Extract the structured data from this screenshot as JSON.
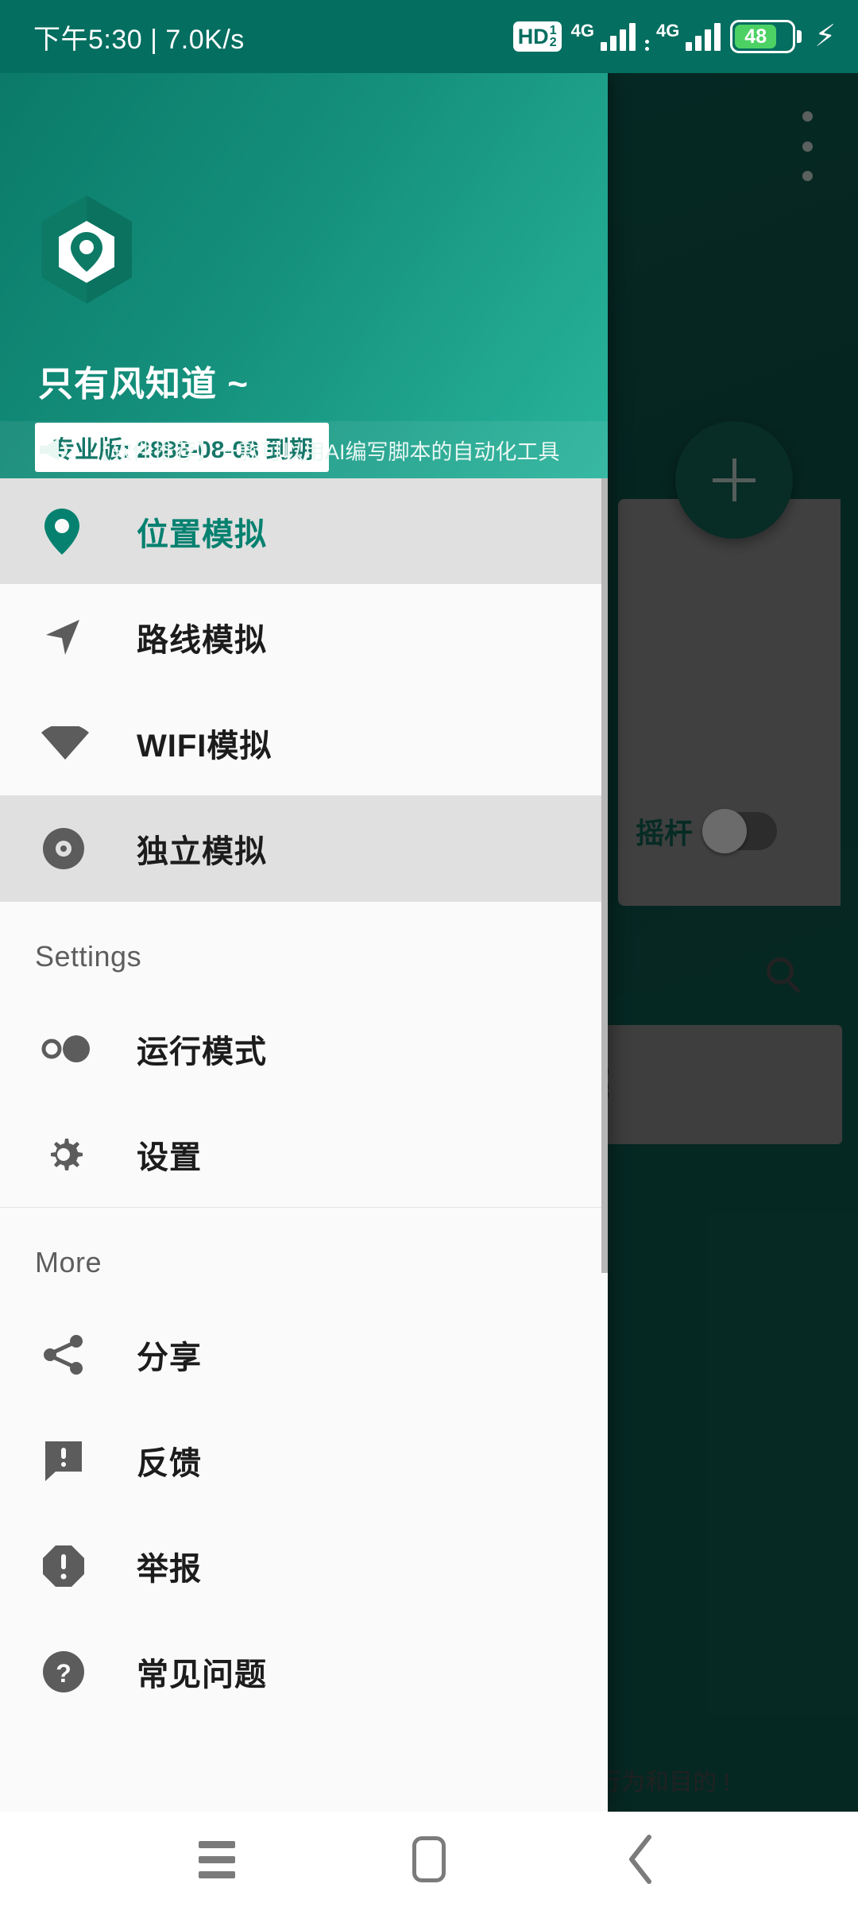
{
  "status_bar": {
    "time_and_speed": "下午5:30 | 7.0K/s",
    "hd_label": "HD",
    "hd_sup": "1",
    "hd_sub": "2",
    "sim1_network": "4G",
    "sim2_network": "4G",
    "battery_percent": "48",
    "charging_icon": "lightning-bolt-icon",
    "accent_color": "#046e60"
  },
  "drawer": {
    "username": "只有风知道 ~",
    "license_badge": "专业版: 2888-08-08 到期",
    "announcement": "【软件推荐】一款可以用AI编写脚本的自动化工具",
    "announcement_icon": "megaphone-icon",
    "logo_icon": "hexagon-location-pin-icon",
    "header_gradient_from": "#0b7a68",
    "header_gradient_to": "#29b49c",
    "active_color": "#068170",
    "primary_items": [
      {
        "label": "位置模拟",
        "icon": "location-pin-icon",
        "active": true,
        "highlighted": true
      },
      {
        "label": "路线模拟",
        "icon": "navigation-arrow-icon",
        "active": false,
        "highlighted": false
      },
      {
        "label": "WIFI模拟",
        "icon": "wifi-icon",
        "active": false,
        "highlighted": false
      },
      {
        "label": "独立模拟",
        "icon": "disc-record-icon",
        "active": false,
        "highlighted": true
      }
    ],
    "settings_section_title": "Settings",
    "settings_items": [
      {
        "label": "运行模式",
        "icon": "run-mode-toggle-icon"
      },
      {
        "label": "设置",
        "icon": "gear-icon"
      }
    ],
    "more_section_title": "More",
    "more_items": [
      {
        "label": "分享",
        "icon": "share-icon"
      },
      {
        "label": "反馈",
        "icon": "feedback-chat-icon"
      },
      {
        "label": "举报",
        "icon": "report-octagon-icon"
      },
      {
        "label": "常见问题",
        "icon": "help-question-icon"
      }
    ]
  },
  "background": {
    "overflow_menu_icon": "more-vertical-icon",
    "fab_icon": "plus-icon",
    "joystick_label": "摇杆",
    "joystick_enabled": false,
    "search_icon": "search-icon",
    "partial_text": "行为和目的 !",
    "map_color": "#0b463d"
  },
  "nav_bar": {
    "recents_icon": "recents-menu-icon",
    "home_icon": "home-square-icon",
    "back_icon": "back-chevron-icon"
  }
}
